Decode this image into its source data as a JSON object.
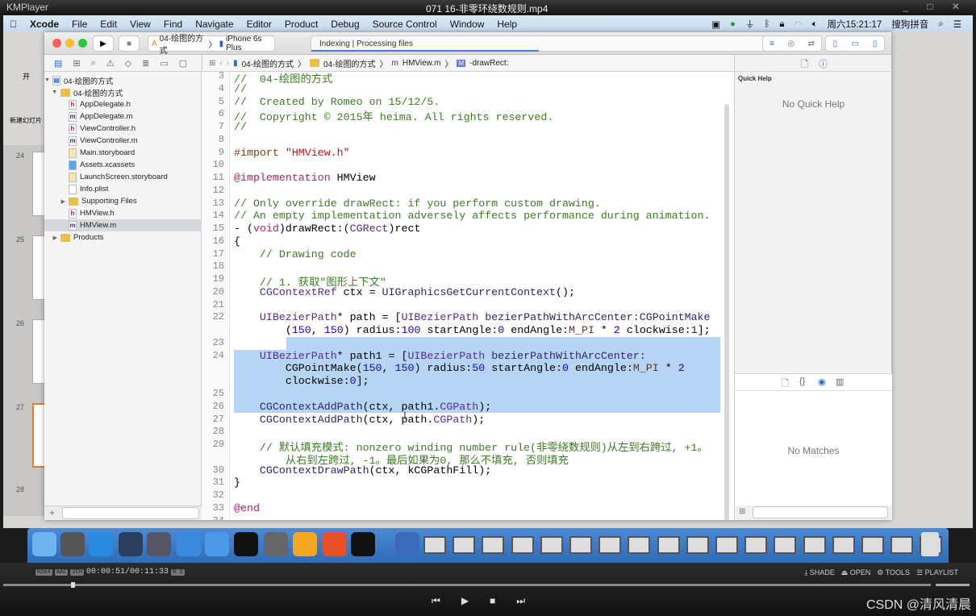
{
  "player": {
    "app": "KMPlayer",
    "file": "071 16-非零环绕数规则.mp4",
    "window_controls": "_ □ ✕",
    "codecs": [
      "H264",
      "AAC",
      "2CH"
    ],
    "time": "00:00:51/00:11:33",
    "rs": "R S",
    "buttons": [
      "SHADE",
      "OPEN",
      "TOOLS",
      "PLAYLIST"
    ],
    "controls": [
      "prev",
      "play",
      "stop",
      "next"
    ],
    "watermark": "CSDN @清风清晨"
  },
  "menubar": {
    "apple": "",
    "app": "Xcode",
    "items": [
      "File",
      "Edit",
      "View",
      "Find",
      "Navigate",
      "Editor",
      "Product",
      "Debug",
      "Source Control",
      "Window",
      "Help"
    ],
    "clock": "周六15:21:17",
    "ime": "搜狗拼音",
    "status_icons": [
      "camera-icon",
      "play-circle-icon",
      "usb-icon",
      "bluetooth-icon",
      "lock-icon",
      "wifi-icon",
      "volume-icon",
      "search-icon",
      "list-icon"
    ]
  },
  "ppt": {
    "tab": "开",
    "new_slide": "新建幻灯片",
    "slide_numbers": [
      "24",
      "25",
      "26",
      "27",
      "28"
    ]
  },
  "toolbar": {
    "scheme": "04-绘图的方式",
    "device": "iPhone 6s Plus",
    "activity": "Indexing  |  Processing files"
  },
  "jumpbar": [
    "04-绘图的方式",
    "04-绘图的方式",
    "HMView.m",
    "-drawRect:"
  ],
  "navigator": {
    "items": [
      {
        "label": "04-绘图的方式",
        "kind": "project",
        "depth": 0,
        "open": true
      },
      {
        "label": "04-绘图的方式",
        "kind": "folder",
        "depth": 1,
        "open": true
      },
      {
        "label": "AppDelegate.h",
        "kind": "h",
        "depth": 2
      },
      {
        "label": "AppDelegate.m",
        "kind": "m",
        "depth": 2
      },
      {
        "label": "ViewController.h",
        "kind": "h",
        "depth": 2
      },
      {
        "label": "ViewController.m",
        "kind": "m",
        "depth": 2
      },
      {
        "label": "Main.storyboard",
        "kind": "storyboard",
        "depth": 2
      },
      {
        "label": "Assets.xcassets",
        "kind": "assets",
        "depth": 2
      },
      {
        "label": "LaunchScreen.storyboard",
        "kind": "storyboard",
        "depth": 2
      },
      {
        "label": "Info.plist",
        "kind": "plist",
        "depth": 2
      },
      {
        "label": "Supporting Files",
        "kind": "folder",
        "depth": 2,
        "open": false
      },
      {
        "label": "HMView.h",
        "kind": "h",
        "depth": 2
      },
      {
        "label": "HMView.m",
        "kind": "m",
        "depth": 2,
        "selected": true
      },
      {
        "label": "Products",
        "kind": "folder",
        "depth": 1,
        "open": false
      }
    ]
  },
  "code": [
    {
      "n": "3",
      "seg": [
        [
          "//  04-绘图的方式",
          "c"
        ]
      ]
    },
    {
      "n": "4",
      "seg": [
        [
          "//",
          "c"
        ]
      ]
    },
    {
      "n": "5",
      "seg": [
        [
          "//  Created by Romeo on 15/12/5.",
          "c"
        ]
      ]
    },
    {
      "n": "6",
      "seg": [
        [
          "//  Copyright © 2015年 heima. All rights reserved.",
          "c"
        ]
      ]
    },
    {
      "n": "7",
      "seg": [
        [
          "//",
          "c"
        ]
      ]
    },
    {
      "n": "8",
      "seg": []
    },
    {
      "n": "9",
      "seg": [
        [
          "#import ",
          "p"
        ],
        [
          "\"HMView.h\"",
          "s"
        ]
      ]
    },
    {
      "n": "10",
      "seg": []
    },
    {
      "n": "11",
      "seg": [
        [
          "@implementation",
          "k"
        ],
        [
          " HMView",
          ""
        ]
      ]
    },
    {
      "n": "12",
      "seg": []
    },
    {
      "n": "13",
      "seg": [
        [
          "// Only override drawRect: if you perform custom drawing.",
          "c"
        ]
      ]
    },
    {
      "n": "14",
      "seg": [
        [
          "// An empty implementation adversely affects performance during animation.",
          "c"
        ]
      ]
    },
    {
      "n": "15",
      "seg": [
        [
          "- (",
          ""
        ],
        [
          "void",
          "k"
        ],
        [
          ")drawRect:(",
          ""
        ],
        [
          "CGRect",
          "t"
        ],
        [
          ")rect",
          ""
        ]
      ]
    },
    {
      "n": "16",
      "seg": [
        [
          "{",
          ""
        ]
      ]
    },
    {
      "n": "17",
      "seg": [
        [
          "    // Drawing code",
          "c"
        ]
      ]
    },
    {
      "n": "18",
      "seg": []
    },
    {
      "n": "19",
      "seg": [
        [
          "    // 1. 获取\"图形上下文\"",
          "c"
        ]
      ]
    },
    {
      "n": "20",
      "seg": [
        [
          "    CGContextRef",
          "t"
        ],
        [
          " ctx = ",
          ""
        ],
        [
          "UIGraphicsGetCurrentContext",
          "f"
        ],
        [
          "();",
          ""
        ]
      ]
    },
    {
      "n": "21",
      "seg": []
    },
    {
      "n": "22",
      "seg": [
        [
          "    UIBezierPath",
          "t"
        ],
        [
          "* path = [",
          ""
        ],
        [
          "UIBezierPath",
          "t"
        ],
        [
          " bezierPathWithArcCenter:",
          "f"
        ],
        [
          "CGPointMake",
          "f"
        ]
      ]
    },
    {
      "n": "",
      "seg": [
        [
          "        (",
          ""
        ],
        [
          "150",
          "n"
        ],
        [
          ", ",
          ""
        ],
        [
          "150",
          "n"
        ],
        [
          ") radius:",
          ""
        ],
        [
          "100",
          "n"
        ],
        [
          " startAngle:",
          ""
        ],
        [
          "0",
          "n"
        ],
        [
          " endAngle:",
          ""
        ],
        [
          "M_PI",
          "mc"
        ],
        [
          " * ",
          ""
        ],
        [
          "2",
          "n"
        ],
        [
          " clockwise:",
          ""
        ],
        [
          "1",
          "n"
        ],
        [
          "];",
          ""
        ]
      ]
    },
    {
      "n": "23",
      "seg": []
    },
    {
      "n": "24",
      "seg": [
        [
          "    UIBezierPath",
          "t"
        ],
        [
          "* path1 = [",
          ""
        ],
        [
          "UIBezierPath",
          "t"
        ],
        [
          " bezierPathWithArcCenter:",
          "f"
        ]
      ]
    },
    {
      "n": "",
      "seg": [
        [
          "        CGPointMake(",
          ""
        ],
        [
          "150",
          "n"
        ],
        [
          ", ",
          ""
        ],
        [
          "150",
          "n"
        ],
        [
          ") radius:",
          ""
        ],
        [
          "50",
          "n"
        ],
        [
          " startAngle:",
          ""
        ],
        [
          "0",
          "n"
        ],
        [
          " endAngle:",
          ""
        ],
        [
          "M_PI",
          "mc"
        ],
        [
          " * ",
          ""
        ],
        [
          "2",
          "n"
        ]
      ]
    },
    {
      "n": "",
      "seg": [
        [
          "        clockwise:",
          ""
        ],
        [
          "0",
          "n"
        ],
        [
          "];",
          ""
        ]
      ]
    },
    {
      "n": "25",
      "seg": []
    },
    {
      "n": "26",
      "seg": [
        [
          "    CGContextAddPath",
          "f"
        ],
        [
          "(ctx, path1.",
          ""
        ],
        [
          "CGPath",
          "t"
        ],
        [
          ");",
          ""
        ]
      ]
    },
    {
      "n": "27",
      "seg": [
        [
          "    CGContextAddPath",
          "f"
        ],
        [
          "(ctx, path.",
          ""
        ],
        [
          "CGPath",
          "t"
        ],
        [
          ");",
          ""
        ]
      ]
    },
    {
      "n": "28",
      "seg": []
    },
    {
      "n": "29",
      "seg": [
        [
          "    // 默认填充模式: nonzero winding number rule(非零绕数规则)从左到右跨过, +1。",
          "c"
        ]
      ]
    },
    {
      "n": "",
      "seg": [
        [
          "        从右到左跨过, -1。最后如果为0, 那么不填充, 否则填充",
          "c"
        ]
      ]
    },
    {
      "n": "30",
      "seg": [
        [
          "    CGContextDrawPath",
          "f"
        ],
        [
          "(ctx, kCGPathFill);",
          ""
        ]
      ]
    },
    {
      "n": "31",
      "seg": [
        [
          "}",
          ""
        ]
      ]
    },
    {
      "n": "32",
      "seg": []
    },
    {
      "n": "33",
      "seg": [
        [
          "@end",
          "k"
        ]
      ]
    },
    {
      "n": "34",
      "seg": []
    }
  ],
  "utilities": {
    "quick_help_title": "Quick Help",
    "no_quick_help": "No Quick Help",
    "no_matches": "No Matches"
  },
  "dock": {
    "apps": [
      "finder-icon",
      "launchpad-icon",
      "safari-icon",
      "mouse-icon",
      "video-icon",
      "xcode-icon",
      "simulator-icon",
      "terminal-icon",
      "system-preferences-icon",
      "sketch-icon",
      "powerpoint-icon",
      "console-icon",
      "media-player-icon"
    ],
    "thumbnail_count": 18
  },
  "colors": {
    "selection": "#b6d4f4",
    "comment": "#3a7d22",
    "keyword": "#b1216a",
    "dock": "#3a7cc8",
    "menubar": "#cfe0f2"
  }
}
